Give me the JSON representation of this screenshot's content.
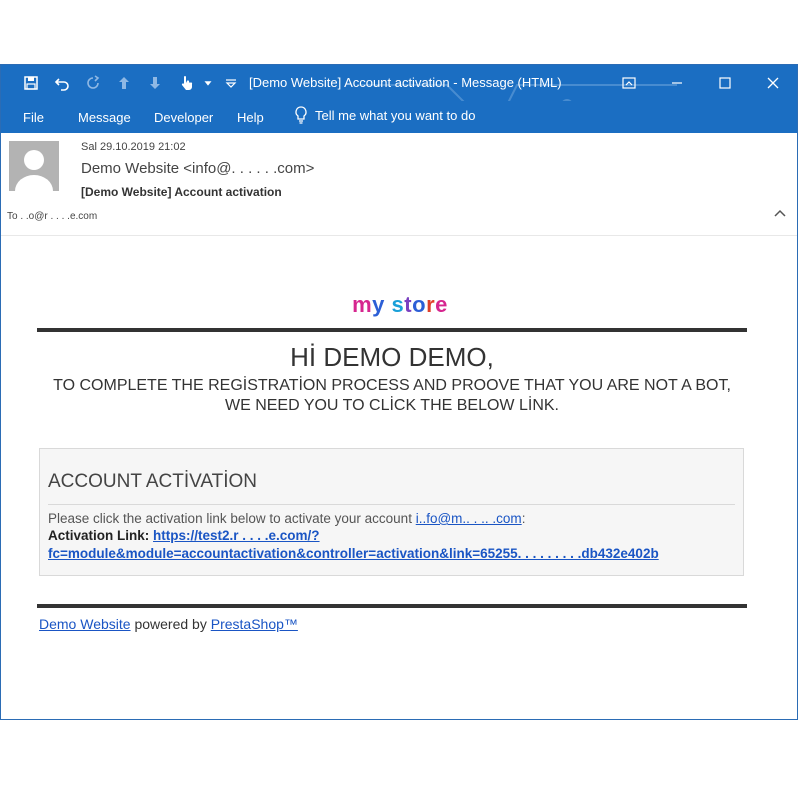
{
  "window": {
    "title": "[Demo Website] Account activation  -  Message (HTML)",
    "accent": "#1b6ec2",
    "quick_access_icons": [
      "save-icon",
      "undo-icon",
      "redo-icon",
      "up-arrow-icon",
      "down-arrow-icon",
      "touch-mode-icon",
      "customize-icon"
    ]
  },
  "menu": {
    "items": [
      "File",
      "Message",
      "Developer",
      "Help"
    ],
    "tell_me": "Tell me what you want to do"
  },
  "header": {
    "date": "Sal 29.10.2019 21:02",
    "from": "Demo Website <info@. .  .  .    . .com>",
    "subject": "[Demo Website] Account activation",
    "to": "To   .  .o@r  .  .  .  .e.com"
  },
  "email": {
    "logo": {
      "m": "m",
      "y": "y",
      "s": "s",
      "t": "t",
      "o": "o",
      "r": "r",
      "e": "e"
    },
    "greeting": "Hİ DEMO DEMO,",
    "instruction": "TO COMPLETE THE REGİSTRATİON PROCESS AND PROOVE THAT YOU ARE NOT A BOT, WE NEED YOU TO CLİCK THE BELOW LİNK.",
    "card": {
      "title": "ACCOUNT ACTİVATİON",
      "text": "Please click the activation link below to activate your account ",
      "email_link": "i..fo@m..   .  .. .com",
      "text_end": ":",
      "link_label": "Activation Link: ",
      "link_part1": "https://test2.r  .   .  .  .e.com/?",
      "link_part2": "fc=module&module=accountactivation&controller=activation&link=65255.  .  .  .  .  .  .  . .db432e402b"
    },
    "footer": {
      "site": "Demo Website",
      "middle": " powered by ",
      "brand": "PrestaShop™"
    }
  }
}
